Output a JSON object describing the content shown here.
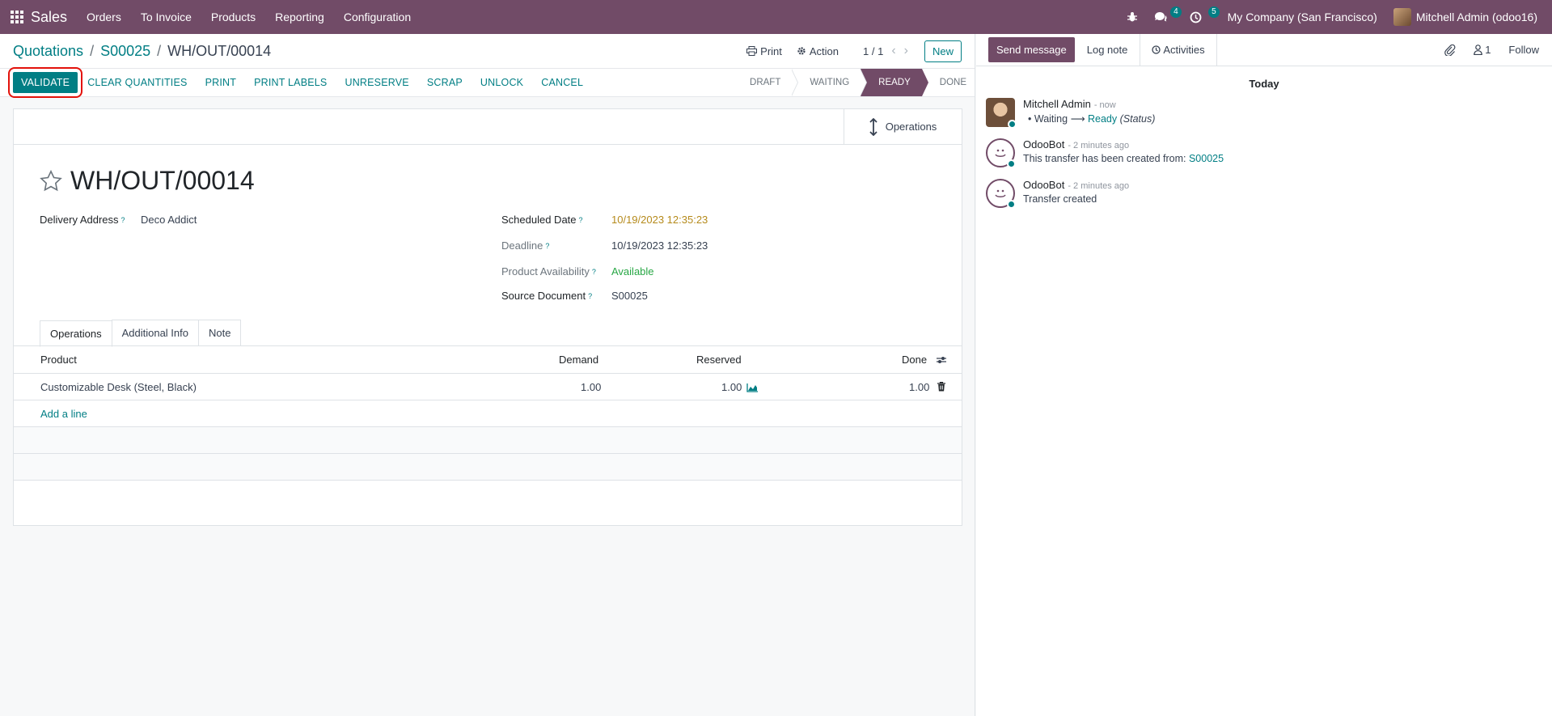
{
  "navbar": {
    "app_name": "Sales",
    "menu": [
      "Orders",
      "To Invoice",
      "Products",
      "Reporting",
      "Configuration"
    ],
    "messages_count": "4",
    "activities_count": "5",
    "company": "My Company (San Francisco)",
    "user": "Mitchell Admin (odoo16)"
  },
  "breadcrumb": {
    "level1": "Quotations",
    "level2": "S00025",
    "current": "WH/OUT/00014"
  },
  "control_panel": {
    "print_label": "Print",
    "action_label": "Action",
    "pager": "1 / 1",
    "new_label": "New"
  },
  "statusbar": {
    "buttons": {
      "validate": "VALIDATE",
      "clear_quantities": "CLEAR QUANTITIES",
      "print": "PRINT",
      "print_labels": "PRINT LABELS",
      "unreserve": "UNRESERVE",
      "scrap": "SCRAP",
      "unlock": "UNLOCK",
      "cancel": "CANCEL"
    },
    "stages": [
      "DRAFT",
      "WAITING",
      "READY",
      "DONE"
    ],
    "active_stage": "READY"
  },
  "form": {
    "smart_button": "Operations",
    "title": "WH/OUT/00014",
    "delivery_address_label": "Delivery Address",
    "delivery_address": "Deco Addict",
    "scheduled_date_label": "Scheduled Date",
    "scheduled_date": "10/19/2023 12:35:23",
    "deadline_label": "Deadline",
    "deadline": "10/19/2023 12:35:23",
    "availability_label": "Product Availability",
    "availability": "Available",
    "source_document_label": "Source Document",
    "source_document": "S00025",
    "tip": "?",
    "tabs": [
      "Operations",
      "Additional Info",
      "Note"
    ],
    "table": {
      "headers": {
        "product": "Product",
        "demand": "Demand",
        "reserved": "Reserved",
        "done": "Done"
      },
      "rows": [
        {
          "product": "Customizable Desk (Steel, Black)",
          "demand": "1.00",
          "reserved": "1.00",
          "done": "1.00"
        }
      ],
      "add_line": "Add a line"
    }
  },
  "chatter": {
    "send_message": "Send message",
    "log_note": "Log note",
    "activities": "Activities",
    "followers_count": "1",
    "follow": "Follow",
    "today": "Today",
    "messages": [
      {
        "author": "Mitchell Admin",
        "time": "- now",
        "from": "Waiting",
        "to": "Ready",
        "field": "(Status)"
      },
      {
        "author": "OdooBot",
        "time": "- 2 minutes ago",
        "text": "This transfer has been created from:",
        "link": "S00025"
      },
      {
        "author": "OdooBot",
        "time": "- 2 minutes ago",
        "text": "Transfer created"
      }
    ]
  },
  "colors": {
    "brand": "#714b67",
    "accent": "#017e84",
    "highlight": "#e3120b",
    "warning_date": "#b58a1b",
    "available": "#28a745"
  }
}
